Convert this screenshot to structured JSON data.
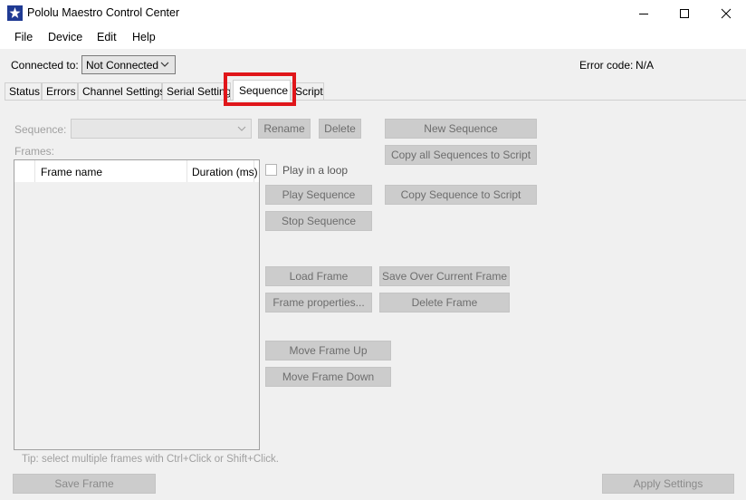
{
  "window": {
    "title": "Pololu Maestro Control Center",
    "icon": "pololu-logo-icon"
  },
  "menu": {
    "items": [
      "File",
      "Device",
      "Edit",
      "Help"
    ]
  },
  "connection": {
    "label": "Connected to:",
    "selected": "Not Connected",
    "error_label": "Error code:",
    "error_value": "N/A"
  },
  "tabs": [
    {
      "label": "Status"
    },
    {
      "label": "Errors"
    },
    {
      "label": "Channel Settings"
    },
    {
      "label": "Serial Settings"
    },
    {
      "label": "Sequence",
      "active": true
    },
    {
      "label": "Script"
    }
  ],
  "sequence": {
    "label": "Sequence:",
    "rename": "Rename",
    "delete": "Delete",
    "new_sequence": "New Sequence",
    "copy_all": "Copy all Sequences to Script",
    "copy_sequence": "Copy Sequence to Script"
  },
  "frames": {
    "label": "Frames:",
    "columns": [
      "Frame name",
      "Duration (ms)"
    ],
    "rows": []
  },
  "controls": {
    "loop_label": "Play in a loop",
    "loop_checked": false,
    "play_sequence": "Play Sequence",
    "stop_sequence": "Stop Sequence",
    "load_frame": "Load Frame",
    "save_over": "Save Over Current Frame",
    "frame_properties": "Frame properties...",
    "delete_frame": "Delete Frame",
    "move_up": "Move Frame Up",
    "move_down": "Move Frame Down"
  },
  "tip": "Tip: select multiple frames with Ctrl+Click or Shift+Click.",
  "footer": {
    "save_frame": "Save Frame",
    "apply_settings": "Apply Settings"
  },
  "colors": {
    "highlight": "#e0161a",
    "icon_blue": "#1f3a93"
  }
}
